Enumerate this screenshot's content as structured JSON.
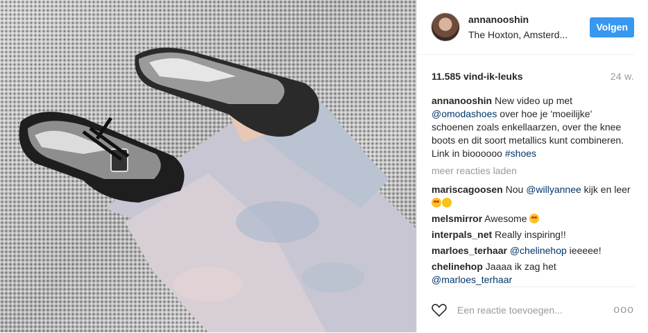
{
  "post": {
    "username": "annanooshin",
    "location": "The Hoxton, Amsterd...",
    "follow_label": "Volgen",
    "likes": "11.585 vind-ik-leuks",
    "age": "24 w.",
    "caption": {
      "user": "annanooshin",
      "text_1": "New video up met",
      "mention": "@omodashoes",
      "text_2": "over hoe je 'moeilijke' schoenen zoals enkellaarzen, over the knee boots en dit soort metallics kunt combineren. Link in bioooooo",
      "hashtag": "#shoes"
    },
    "more_comments": "meer reacties laden",
    "comments": [
      {
        "user": "mariscagoosen",
        "text": "Nou",
        "mention": "@willyannee",
        "text_after": "kijk en leer"
      },
      {
        "user": "melsmirror",
        "text": "Awesome"
      },
      {
        "user": "interpals_net",
        "text": "Really inspiring!!"
      },
      {
        "user": "marloes_terhaar",
        "mention": "@chelinehop",
        "text_after": "ieeeee!"
      },
      {
        "user": "chelinehop",
        "text": "Jaaaa ik zag het",
        "mention": "@marloes_terhaar"
      }
    ],
    "comment_placeholder": "Een reactie toevoegen...",
    "options_label": "ooo"
  },
  "colors": {
    "accent": "#3897f0",
    "link": "#003569",
    "muted": "#999999"
  },
  "icons": [
    "heart-icon",
    "more-options-icon"
  ]
}
